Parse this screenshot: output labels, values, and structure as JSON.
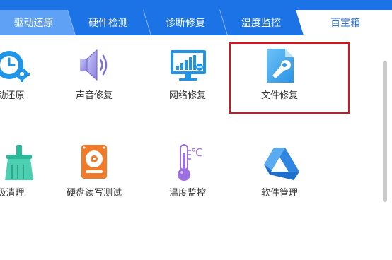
{
  "tabs": [
    {
      "label": "驱动还原",
      "active": false
    },
    {
      "label": "硬件检测",
      "active": false
    },
    {
      "label": "诊断修复",
      "active": false
    },
    {
      "label": "温度监控",
      "active": false
    },
    {
      "label": "百宝箱",
      "active": true
    }
  ],
  "tools": [
    {
      "label": "动还原",
      "icon": "clock-gear-icon"
    },
    {
      "label": "声音修复",
      "icon": "speaker-icon"
    },
    {
      "label": "网络修复",
      "icon": "network-monitor-icon"
    },
    {
      "label": "文件修复",
      "icon": "file-wrench-icon"
    },
    {
      "label": "圾清理",
      "icon": "broom-icon"
    },
    {
      "label": "硬盘读写测试",
      "icon": "hard-disk-icon"
    },
    {
      "label": "温度监控",
      "icon": "thermometer-icon"
    },
    {
      "label": "软件管理",
      "icon": "software-triangle-icon"
    }
  ],
  "thermometer_unit": "℃",
  "colors": {
    "tab_active": "#2a6fd4",
    "tab_bar": "#1b73e6",
    "tab_first": "#5ea1f5",
    "highlight": "#d6141c"
  }
}
